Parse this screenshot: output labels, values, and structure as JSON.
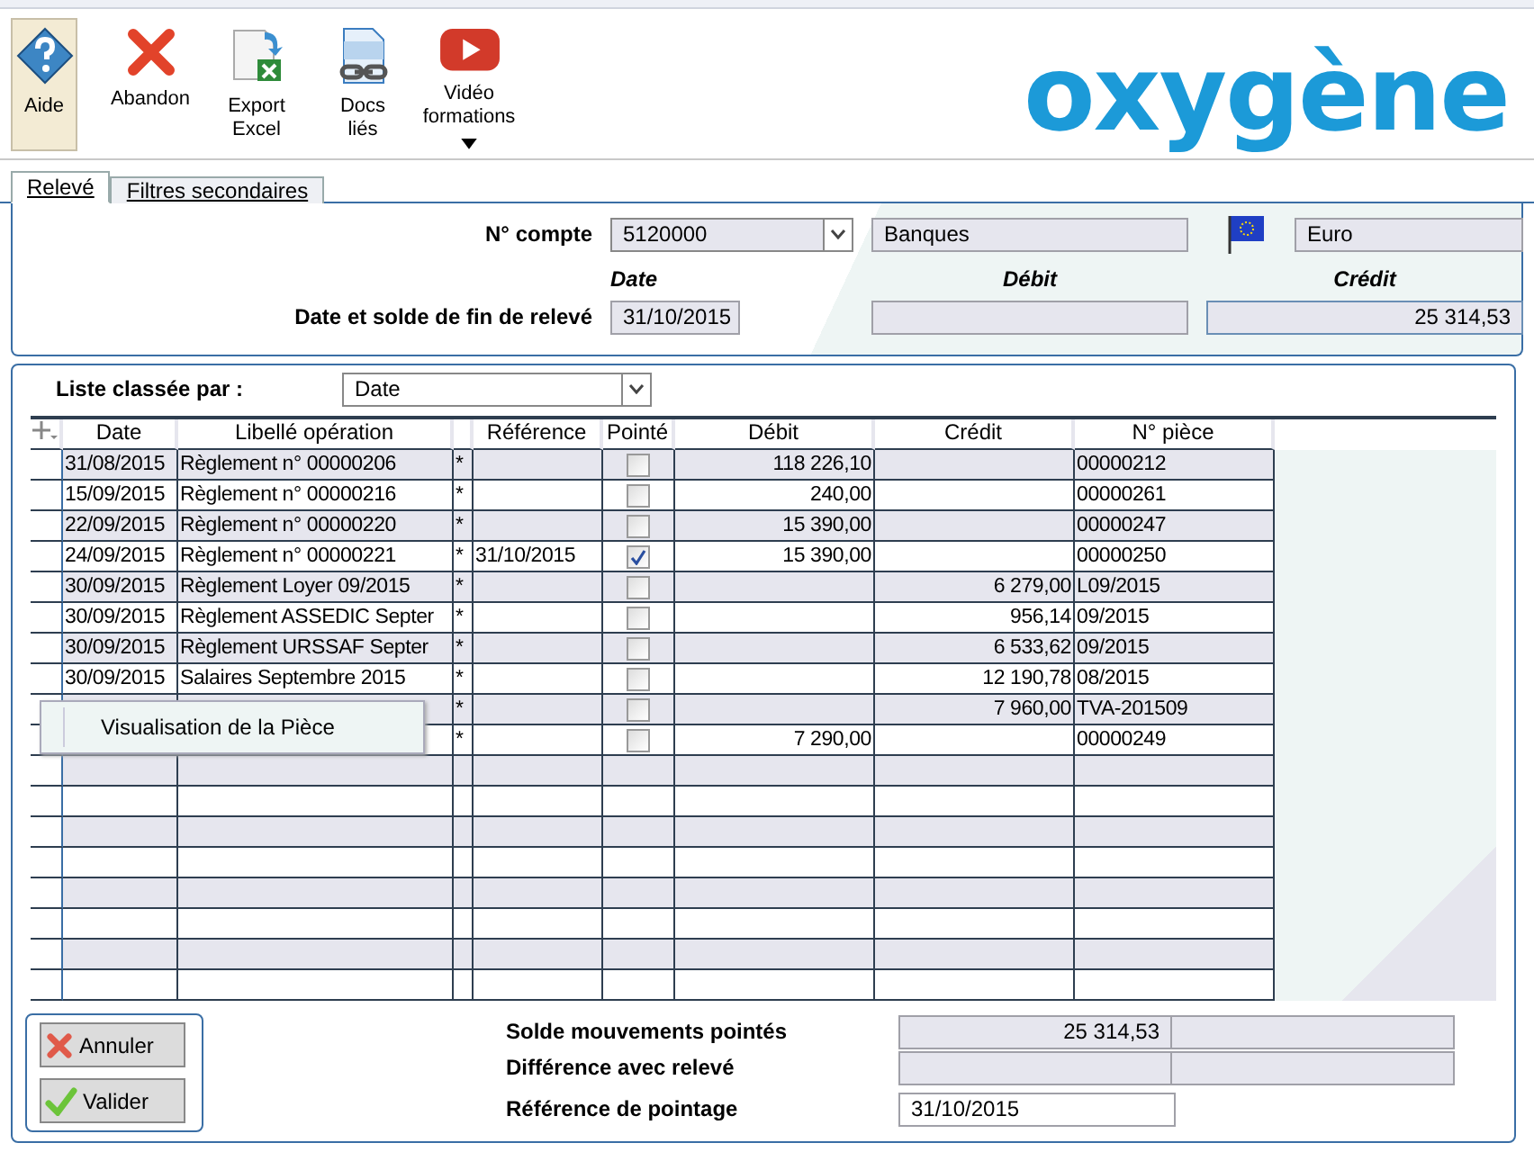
{
  "toolbar": [
    {
      "kind": "help",
      "label": "Aide",
      "selected": true
    },
    {
      "kind": "cancel",
      "label": "Abandon",
      "selected": false
    },
    {
      "kind": "excel",
      "label": "Export\nExcel",
      "selected": false
    },
    {
      "kind": "docs",
      "label": "Docs\nliés",
      "selected": false
    },
    {
      "kind": "video",
      "label": "Vidéo\nformations",
      "selected": false,
      "dropdown": true
    }
  ],
  "logo": "oxygène",
  "tabs": [
    {
      "label": "Relevé",
      "selected": true
    },
    {
      "label": "Filtres secondaires",
      "selected": false
    }
  ],
  "account": {
    "label": "N° compte",
    "number": "5120000",
    "name": "Banques",
    "currency": "Euro",
    "date_header": "Date",
    "debit_header": "Débit",
    "credit_header": "Crédit",
    "end_label": "Date et solde de fin de relevé",
    "end_date": "31/10/2015",
    "end_credit": "25 314,53"
  },
  "sort": {
    "label": "Liste classée par :",
    "value": "Date"
  },
  "table": {
    "columns": [
      "Date",
      "Libellé opération",
      "",
      "Référence",
      "Pointé",
      "Débit",
      "Crédit",
      "N° pièce"
    ],
    "rows": [
      {
        "date": "31/08/2015",
        "label": "Règlement n° 00000206",
        "mark": "*",
        "reference": "",
        "checked": false,
        "debit": "118 226,10",
        "credit": "",
        "piece": "00000212"
      },
      {
        "date": "15/09/2015",
        "label": "Règlement n° 00000216",
        "mark": "*",
        "reference": "",
        "checked": false,
        "debit": "240,00",
        "credit": "",
        "piece": "00000261"
      },
      {
        "date": "22/09/2015",
        "label": "Règlement n° 00000220",
        "mark": "*",
        "reference": "",
        "checked": false,
        "debit": "15 390,00",
        "credit": "",
        "piece": "00000247"
      },
      {
        "date": "24/09/2015",
        "label": "Règlement n° 00000221",
        "mark": "*",
        "reference": "31/10/2015",
        "checked": true,
        "debit": "15 390,00",
        "credit": "",
        "piece": "00000250"
      },
      {
        "date": "30/09/2015",
        "label": "Règlement Loyer 09/2015",
        "mark": "*",
        "reference": "",
        "checked": false,
        "debit": "",
        "credit": "6 279,00",
        "piece": "L09/2015"
      },
      {
        "date": "30/09/2015",
        "label": "Règlement ASSEDIC Septer",
        "mark": "*",
        "reference": "",
        "checked": false,
        "debit": "",
        "credit": "956,14",
        "piece": "09/2015"
      },
      {
        "date": "30/09/2015",
        "label": "Règlement URSSAF Septer",
        "mark": "*",
        "reference": "",
        "checked": false,
        "debit": "",
        "credit": "6 533,62",
        "piece": "09/2015"
      },
      {
        "date": "30/09/2015",
        "label": "Salaires Septembre 2015",
        "mark": "*",
        "reference": "",
        "checked": false,
        "debit": "",
        "credit": "12 190,78",
        "piece": "08/2015"
      },
      {
        "date": "",
        "label": "",
        "mark": "*",
        "reference": "",
        "checked": false,
        "debit": "",
        "credit": "7 960,00",
        "piece": "TVA-201509"
      },
      {
        "date": "",
        "label": "",
        "mark": "*",
        "reference": "",
        "checked": false,
        "debit": "7 290,00",
        "credit": "",
        "piece": "00000249"
      }
    ]
  },
  "context_menu": {
    "items": [
      "Visualisation de la Pièce"
    ]
  },
  "buttons": [
    {
      "kind": "cancel",
      "label": "Annuler"
    },
    {
      "kind": "ok",
      "label": "Valider"
    }
  ],
  "summary": [
    {
      "label": "Solde mouvements pointés",
      "value": "25 314,53"
    },
    {
      "label": "Différence avec relevé"
    }
  ],
  "reference": {
    "label": "Référence de pointage",
    "value": "31/10/2015"
  }
}
